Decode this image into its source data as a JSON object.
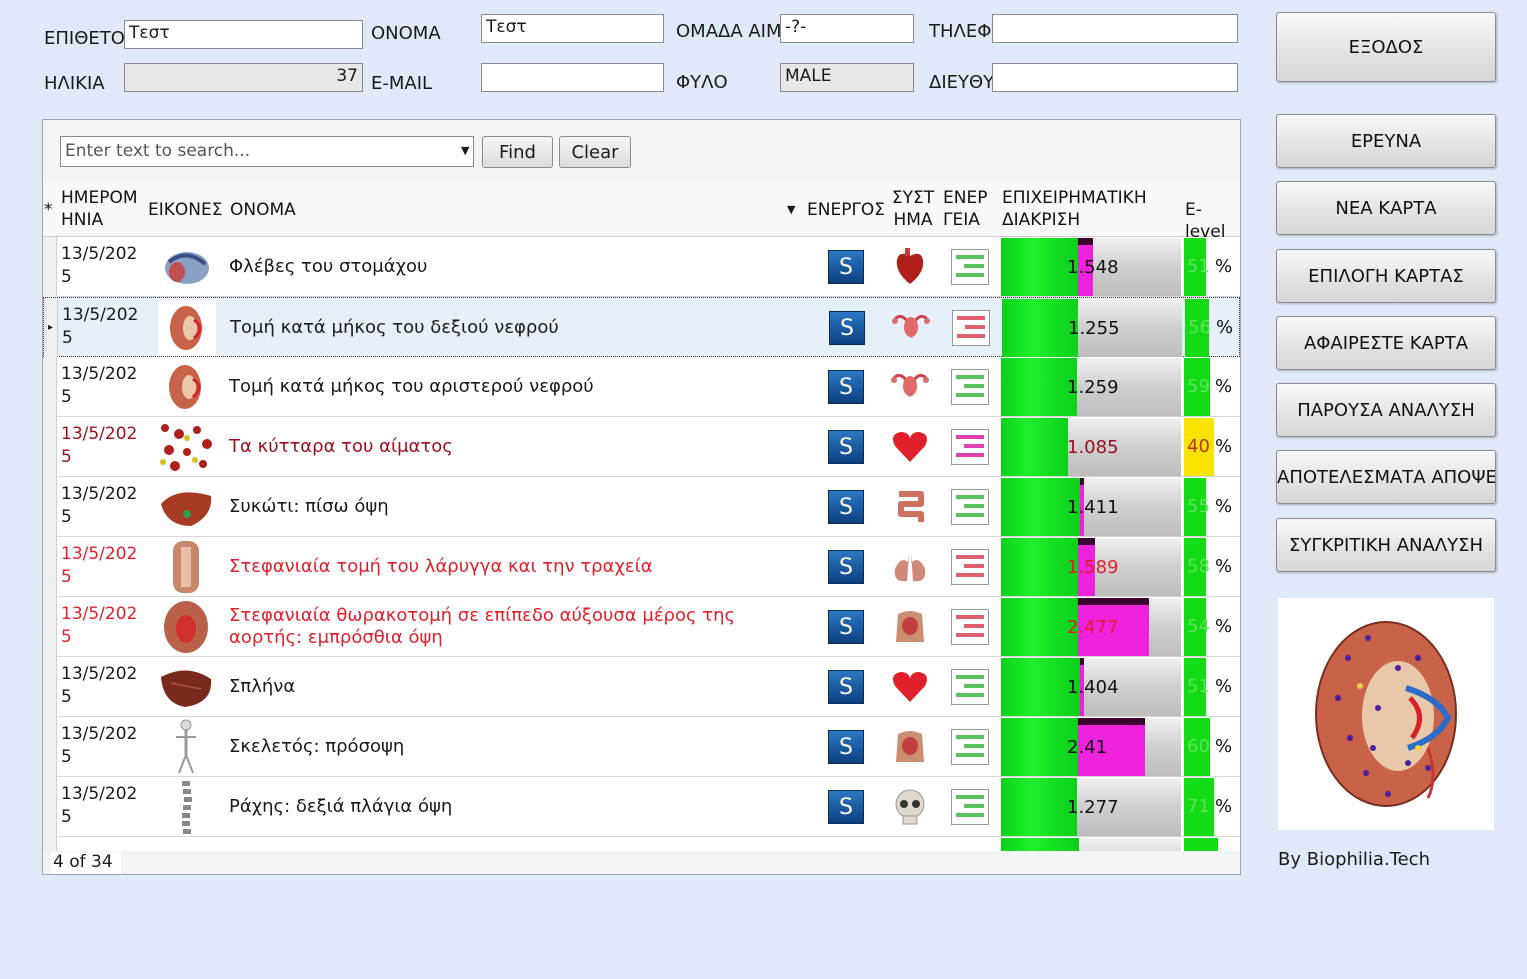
{
  "form": {
    "surname_label": "ΕΠΙΘΕΤΟ",
    "surname_value": "Τεστ",
    "name_label": "ΟΝΟΜΑ",
    "name_value": "Τεστ",
    "blood_label": "ΟΜΑΔΑ ΑΙΜ",
    "blood_value": "-?-",
    "phone_label": "ΤΗΛΕΦ",
    "phone_value": "",
    "age_label": "ΗΛΙΚΙΑ",
    "age_value": "37",
    "email_label": "E-MAIL",
    "email_value": "",
    "sex_label": "ΦΥΛΟ",
    "sex_value": "MALE",
    "address_label": "ΔΙΕΥΘΥ",
    "address_value": ""
  },
  "sidebar": {
    "exit": "ΕΞΟΔΟΣ",
    "research": "ΕΡΕΥΝΑ",
    "new_card": "ΝΕΑ ΚΑΡΤΑ",
    "select_card": "ΕΠΙΛΟΓΗ ΚΑΡΤΑΣ",
    "remove_card": "ΑΦΑΙΡΕΣΤΕ ΚΑΡΤΑ",
    "current_analysis": "ΠΑΡΟΥΣΑ ΑΝΑΛΥΣΗ",
    "results": "ΑΠΟΤΕΛΕΣΜΑΤΑ ΑΠΟΨΕΩΝ",
    "comparative": "ΣΥΓΚΡΙΤΙΚΗ ΑΝΑΛΥΣΗ",
    "credit": "By Biophilia.Tech"
  },
  "search": {
    "placeholder": "Enter text to search...",
    "find": "Find",
    "clear": "Clear"
  },
  "columns": {
    "marker": "*",
    "date": "ΗΜΕΡΟΜΗΝΙΑ",
    "images": "ΕΙΚΟΝΕΣ",
    "name": "ΟΝΟΜΑ",
    "active": "ΕΝΕΡΓΟΣ",
    "system": "ΣΥΣΤΗΜΑ",
    "energy": "ΕΝΕΡΓΕΙΑ",
    "business": "ΕΠΙΧΕΙΡΗΜΑΤΙΚΗ ΔΙΑΚΡΙΣΗ",
    "elevel": "E-level"
  },
  "rows": [
    {
      "date": "13/5/2025",
      "name": "Φλέβες του στομάχου",
      "color": "normal",
      "img": "stomach-veins-icon",
      "active": "S",
      "system": "heart-organ-icon",
      "energy": "green",
      "value": "1.548",
      "green": 0.43,
      "magenta": 0.08,
      "elevel": "51",
      "elevel_color": "#14dc14",
      "elevel_width": 0.55,
      "pct": "%"
    },
    {
      "date": "13/5/2025",
      "name": "Τομή κατά μήκος του δεξιού νεφρού",
      "color": "normal",
      "img": "kidney-icon",
      "active": "S",
      "system": "uterus-icon",
      "energy": "red",
      "value": "1.255",
      "green": 0.42,
      "magenta": 0.0,
      "elevel": "56",
      "elevel_color": "#14dc14",
      "elevel_width": 0.6,
      "pct": "%",
      "selected": true
    },
    {
      "date": "13/5/2025",
      "name": "Τομή κατά μήκος του αριστερού νεφρού",
      "color": "normal",
      "img": "kidney-icon",
      "active": "S",
      "system": "uterus-icon",
      "energy": "green",
      "value": "1.259",
      "green": 0.42,
      "magenta": 0.0,
      "elevel": "59",
      "elevel_color": "#14dc14",
      "elevel_width": 0.65,
      "pct": "%"
    },
    {
      "date": "13/5/2025",
      "name": "Τα κύτταρα του αίματος",
      "color": "dred",
      "img": "blood-cells-icon",
      "active": "S",
      "system": "heart-icon",
      "energy": "magenta",
      "value": "1.085",
      "green": 0.37,
      "magenta": 0.0,
      "elevel": "40",
      "elevel_color": "#f6e300",
      "elevel_width": 0.75,
      "pct": "%"
    },
    {
      "date": "13/5/2025",
      "name": "Συκώτι: πίσω όψη",
      "color": "normal",
      "img": "liver-icon",
      "active": "S",
      "system": "intestine-icon",
      "energy": "green",
      "value": "1.411",
      "green": 0.44,
      "magenta": 0.02,
      "elevel": "55",
      "elevel_color": "#14dc14",
      "elevel_width": 0.55,
      "pct": "%"
    },
    {
      "date": "13/5/2025",
      "name": "Στεφανιαία τομή του λάρυγγα και την τραχεία",
      "color": "red",
      "img": "larynx-icon",
      "active": "S",
      "system": "lungs-icon",
      "energy": "red",
      "value": "1.589",
      "green": 0.43,
      "magenta": 0.09,
      "elevel": "58",
      "elevel_color": "#14dc14",
      "elevel_width": 0.55,
      "pct": "%"
    },
    {
      "date": "13/5/2025",
      "name": "Στεφανιαία θωρακοτομή σε επίπεδο αύξουσα μέρος της αορτής: εμπρόσθια όψη",
      "color": "red",
      "img": "thorax-icon",
      "active": "S",
      "system": "torso-icon",
      "energy": "red",
      "value": "2.477",
      "green": 0.43,
      "magenta": 0.39,
      "elevel": "54",
      "elevel_color": "#14dc14",
      "elevel_width": 0.55,
      "pct": "%"
    },
    {
      "date": "13/5/2025",
      "name": "Σπλήνα",
      "color": "normal",
      "img": "spleen-icon",
      "active": "S",
      "system": "heart-icon",
      "energy": "green",
      "value": "1.404",
      "green": 0.44,
      "magenta": 0.02,
      "elevel": "51",
      "elevel_color": "#14dc14",
      "elevel_width": 0.55,
      "pct": "%"
    },
    {
      "date": "13/5/2025",
      "name": "Σκελετός: πρόσοψη",
      "color": "normal",
      "img": "skeleton-icon",
      "active": "S",
      "system": "torso-icon",
      "energy": "green",
      "value": "2.41",
      "green": 0.43,
      "magenta": 0.37,
      "elevel": "60",
      "elevel_color": "#14dc14",
      "elevel_width": 0.65,
      "pct": "%"
    },
    {
      "date": "13/5/2025",
      "name": "Ράχης: δεξιά πλάγια όψη",
      "color": "normal",
      "img": "spine-icon",
      "active": "S",
      "system": "skull-icon",
      "energy": "green",
      "value": "1.277",
      "green": 0.42,
      "magenta": 0.0,
      "elevel": "71",
      "elevel_color": "#14dc14",
      "elevel_width": 0.75,
      "pct": "%"
    }
  ],
  "status": "4 of 34"
}
